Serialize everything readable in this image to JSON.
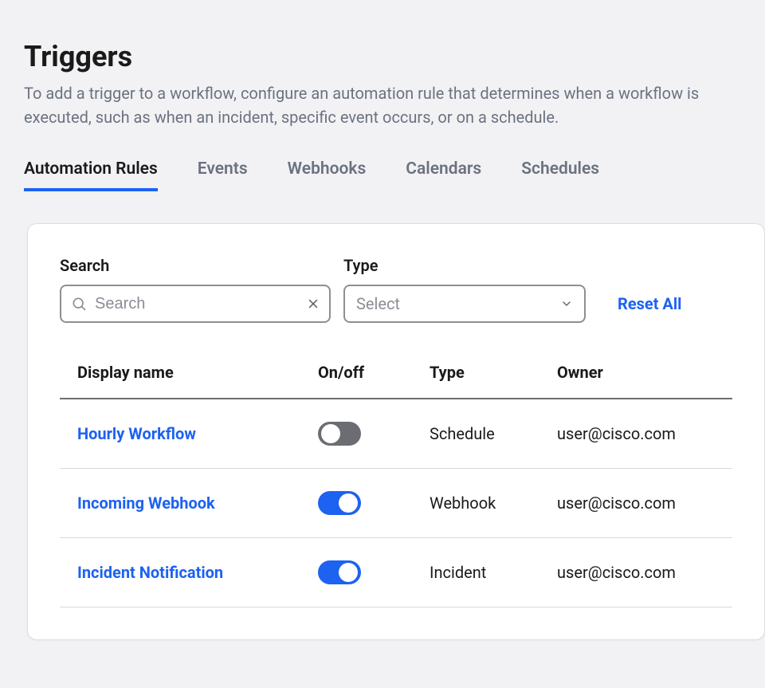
{
  "header": {
    "title": "Triggers",
    "description": "To add a trigger to a workflow, configure an automation rule that determines when a workflow is executed, such as when an incident, specific event occurs, or on a schedule."
  },
  "tabs": [
    {
      "label": "Automation Rules",
      "active": true
    },
    {
      "label": "Events",
      "active": false
    },
    {
      "label": "Webhooks",
      "active": false
    },
    {
      "label": "Calendars",
      "active": false
    },
    {
      "label": "Schedules",
      "active": false
    }
  ],
  "filters": {
    "search_label": "Search",
    "search_placeholder": "Search",
    "search_value": "",
    "type_label": "Type",
    "type_placeholder": "Select",
    "reset_label": "Reset All"
  },
  "table": {
    "columns": [
      "Display name",
      "On/off",
      "Type",
      "Owner"
    ],
    "rows": [
      {
        "name": "Hourly Workflow",
        "on": false,
        "type": "Schedule",
        "owner": "user@cisco.com"
      },
      {
        "name": "Incoming Webhook",
        "on": true,
        "type": "Webhook",
        "owner": "user@cisco.com"
      },
      {
        "name": "Incident Notification",
        "on": true,
        "type": "Incident",
        "owner": "user@cisco.com"
      }
    ]
  }
}
